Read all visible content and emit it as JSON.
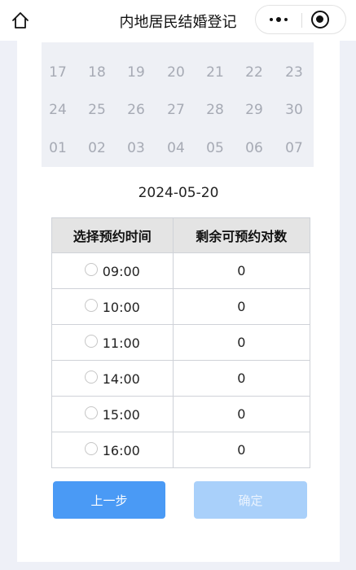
{
  "nav": {
    "title": "内地居民结婚登记",
    "home_icon": "home-icon",
    "more_icon": "more-dots-icon",
    "close_icon": "close-miniprogram-icon"
  },
  "calendar": {
    "rows": [
      [
        "17",
        "18",
        "19",
        "20",
        "21",
        "22",
        "23"
      ],
      [
        "24",
        "25",
        "26",
        "27",
        "28",
        "29",
        "30"
      ],
      [
        "01",
        "02",
        "03",
        "04",
        "05",
        "06",
        "07"
      ]
    ]
  },
  "selected_date": "2024-05-20",
  "table": {
    "headers": [
      "选择预约时间",
      "剩余可预约对数"
    ],
    "rows": [
      {
        "time": "09:00",
        "remaining": "0"
      },
      {
        "time": "10:00",
        "remaining": "0"
      },
      {
        "time": "11:00",
        "remaining": "0"
      },
      {
        "time": "14:00",
        "remaining": "0"
      },
      {
        "time": "15:00",
        "remaining": "0"
      },
      {
        "time": "16:00",
        "remaining": "0"
      }
    ]
  },
  "buttons": {
    "prev_label": "上一步",
    "confirm_label": "确定"
  },
  "colors": {
    "primary": "#4a9af5",
    "primary_disabled": "#a9d0fa",
    "page_bg": "#eef0f7"
  }
}
